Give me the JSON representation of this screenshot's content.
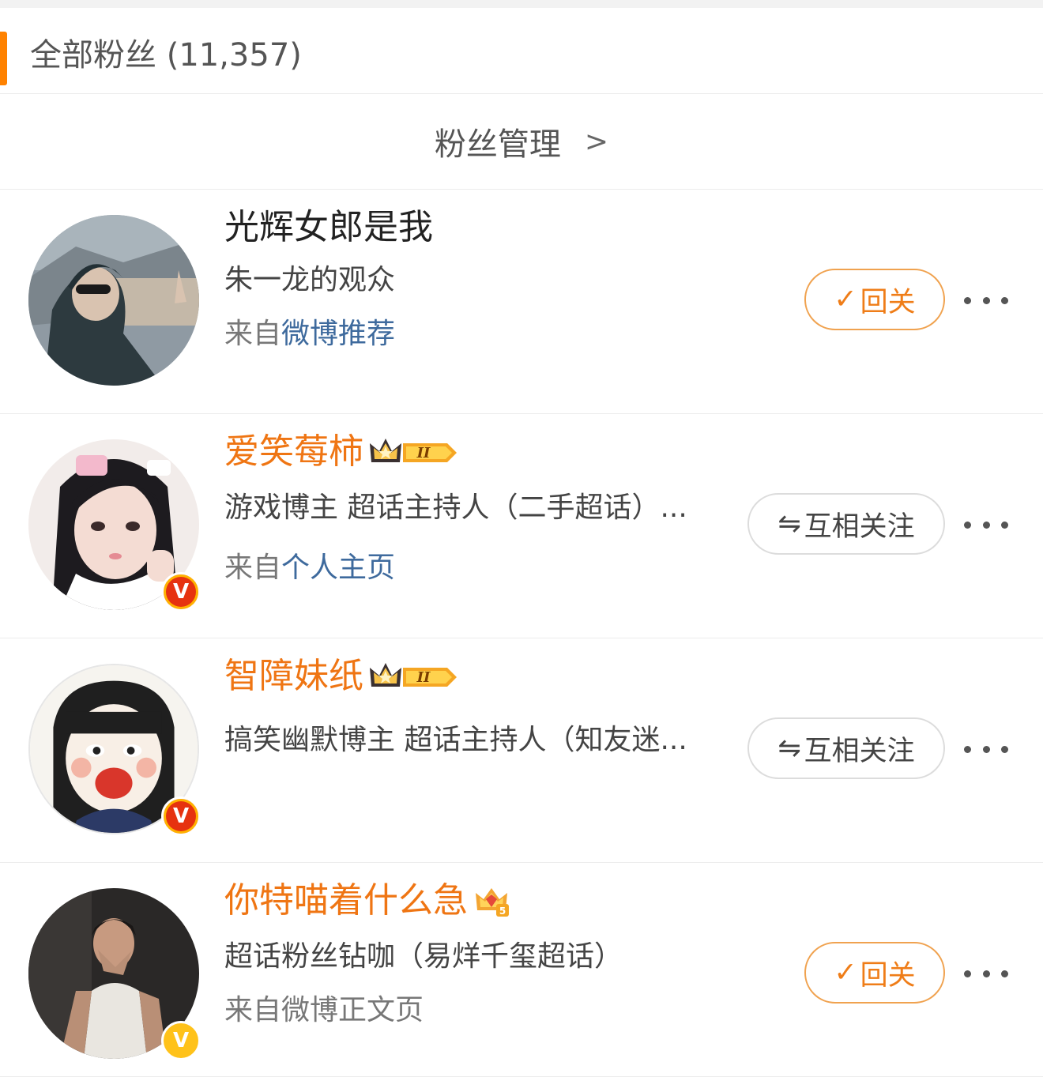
{
  "header": {
    "title": "全部粉丝 (11,357)"
  },
  "manage": {
    "label": "粉丝管理",
    "chevron": ">"
  },
  "fans": [
    {
      "name": "光辉女郎是我",
      "desc": "朱一龙的观众",
      "source_prefix": "来自",
      "source_link": "微博推荐",
      "button_icon": "✓",
      "button_label": "回关"
    },
    {
      "name": "爱笑莓柿",
      "desc": "游戏博主 超话主持人（二手超话）...",
      "source_prefix": "来自",
      "source_link": "个人主页",
      "button_icon": "⇋",
      "button_label": "互相关注",
      "verify_badge": "V"
    },
    {
      "name": "智障妹纸",
      "desc": "搞笑幽默博主 超话主持人（知友迷...",
      "button_icon": "⇋",
      "button_label": "互相关注",
      "verify_badge": "V"
    },
    {
      "name": "你特喵着什么急",
      "desc": "超话粉丝钻咖（易烊千玺超话）",
      "source_prefix": "来自微博正文页",
      "button_icon": "✓",
      "button_label": "回关",
      "verify_badge": "V"
    }
  ],
  "colors": {
    "accent": "#ff8200",
    "name_orange": "#ef7513",
    "link_blue": "#3e6a9d"
  }
}
